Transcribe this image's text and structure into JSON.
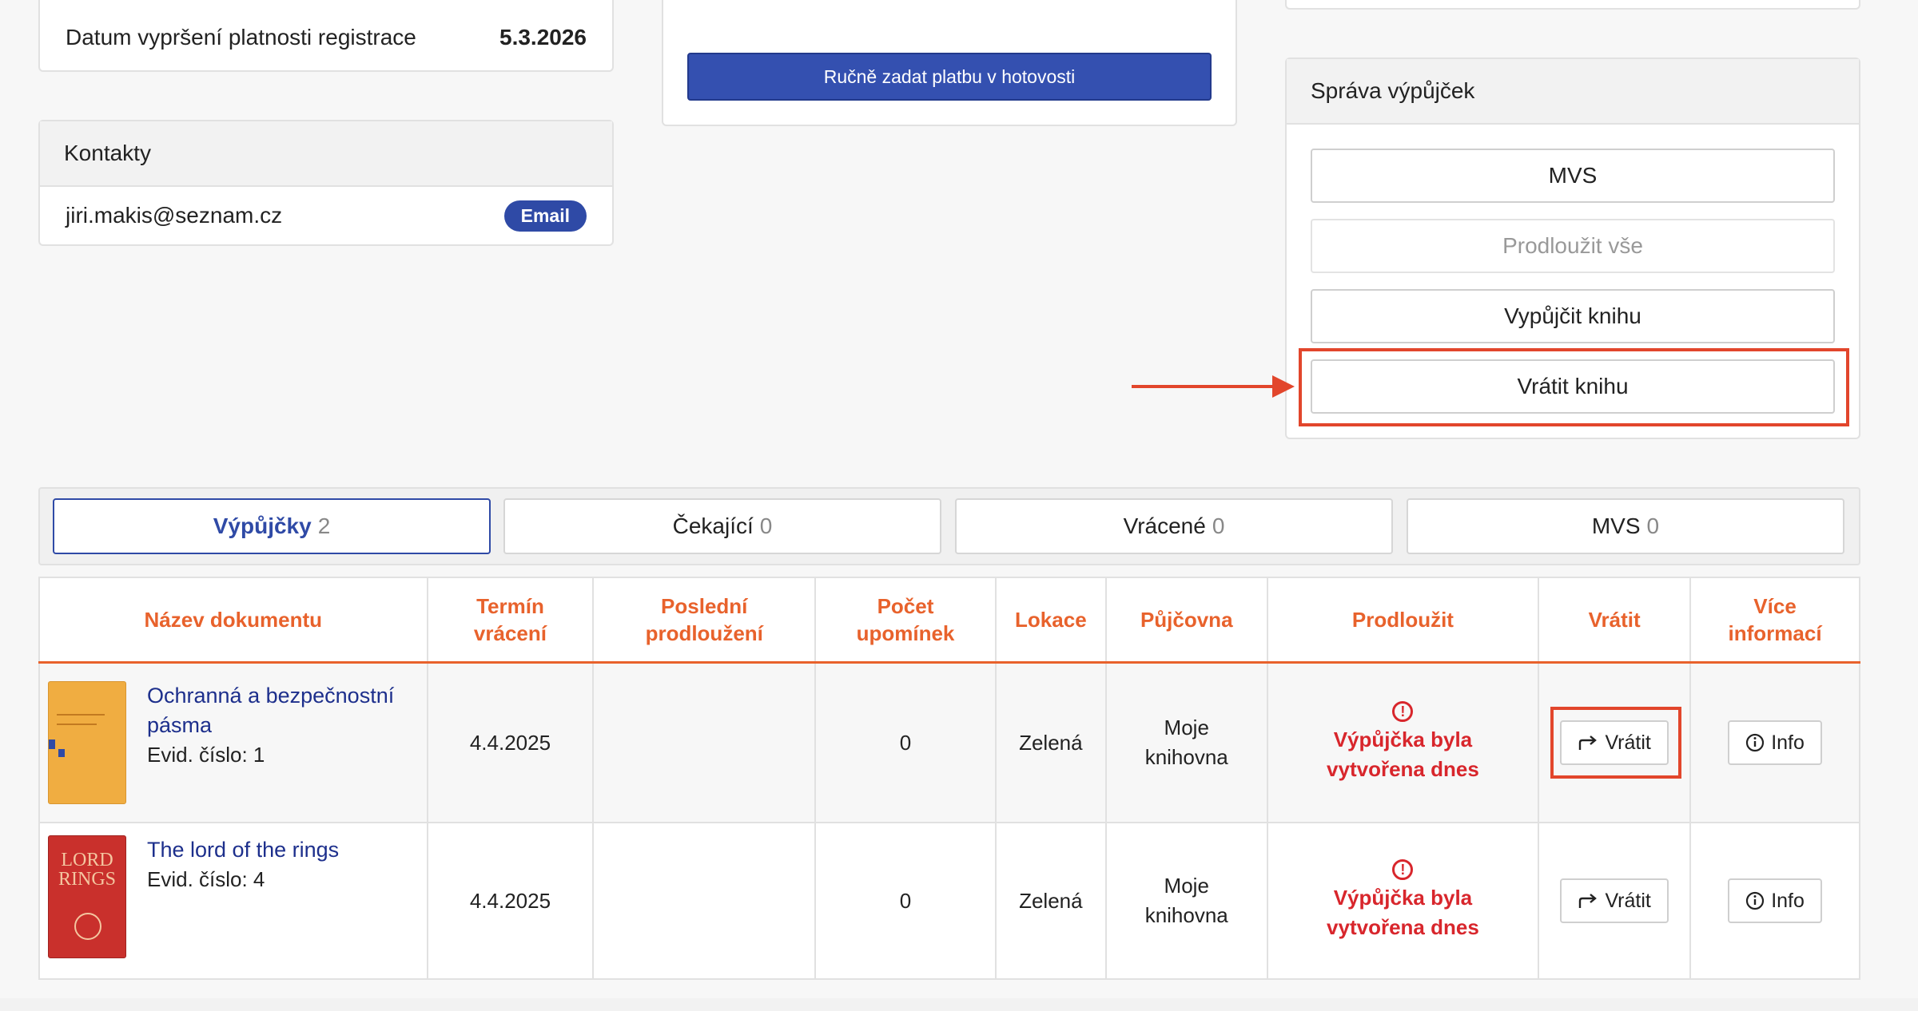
{
  "registration": {
    "label": "Datum vypršení platnosti registrace",
    "value": "5.3.2026"
  },
  "contacts": {
    "title": "Kontakty",
    "email": "jiri.makis@seznam.cz",
    "badge": "Email"
  },
  "payment": {
    "cash_button": "Ručně zadat platbu v hotovosti"
  },
  "loan_management": {
    "title": "Správa výpůjček",
    "buttons": [
      {
        "label": "MVS"
      },
      {
        "label": "Prodloužit vše"
      },
      {
        "label": "Vypůjčit knihu"
      },
      {
        "label": "Vrátit knihu"
      }
    ]
  },
  "tabs": [
    {
      "label": "Výpůjčky",
      "count": "2"
    },
    {
      "label": "Čekající",
      "count": "0"
    },
    {
      "label": "Vrácené",
      "count": "0"
    },
    {
      "label": "MVS",
      "count": "0"
    }
  ],
  "table": {
    "headers": {
      "name": "Název dokumentu",
      "due_1": "Termín",
      "due_2": "vrácení",
      "last_1": "Poslední",
      "last_2": "prodloužení",
      "rem_1": "Počet",
      "rem_2": "upomínek",
      "location": "Lokace",
      "library": "Půjčovna",
      "extend": "Prodloužit",
      "return": "Vrátit",
      "more_1": "Více",
      "more_2": "informací"
    },
    "rows": [
      {
        "title_1": "Ochranná a bezpečnostní",
        "title_2": "pásma",
        "evid": "Evid. číslo: 1",
        "due": "4.4.2025",
        "last_extension": "",
        "reminders": "0",
        "location": "Zelená",
        "library_1": "Moje",
        "library_2": "knihovna",
        "status_1": "Výpůjčka byla",
        "status_2": "vytvořena dnes",
        "return_btn": "Vrátit",
        "info_btn": "Info"
      },
      {
        "title_1": "The lord of the rings",
        "title_2": "",
        "evid": "Evid. číslo: 4",
        "due": "4.4.2025",
        "last_extension": "",
        "reminders": "0",
        "location": "Zelená",
        "library_1": "Moje",
        "library_2": "knihovna",
        "status_1": "Výpůjčka byla",
        "status_2": "vytvořena dnes",
        "return_btn": "Vrátit",
        "info_btn": "Info"
      }
    ]
  },
  "colors": {
    "primary": "#3450b0",
    "accent": "#e8622c",
    "highlight": "#e2462c",
    "error": "#d8262c",
    "link": "#1d2f8c"
  }
}
